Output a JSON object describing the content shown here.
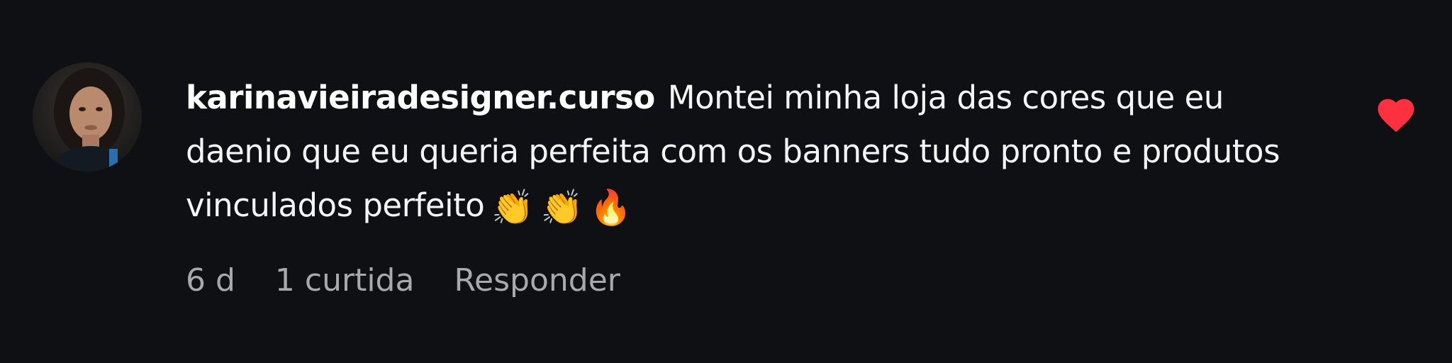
{
  "comment": {
    "username": "karinavieiradesigner.curso",
    "lines": [
      "Montei minha loja das cores que eu",
      "daenio que eu queria perfeita com os banners tudo pronto e produtos",
      "vinculados perfeito"
    ],
    "emojis": [
      "👏",
      "👏",
      "🔥"
    ],
    "age": "6 d",
    "likes": "1 curtida",
    "reply_label": "Responder",
    "like_icon": "heart-icon",
    "like_color": "#ff3040"
  }
}
